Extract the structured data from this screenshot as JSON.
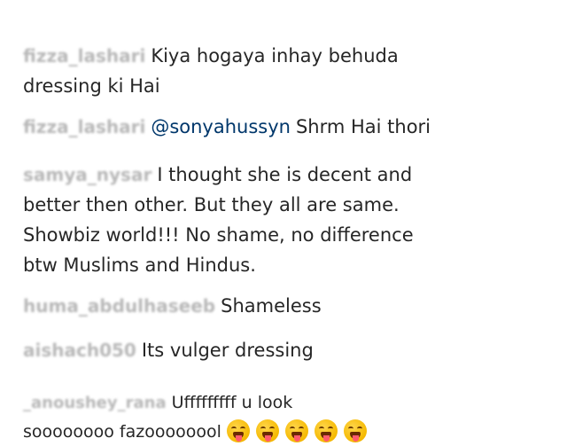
{
  "comments": [
    {
      "user": "fizza_lashari",
      "text": "Kiya hogaya inhay behuda\ndressing ki Hai"
    },
    {
      "user": "fizza_lashari",
      "mention": "@sonyahussyn",
      "text": "Shrm Hai thori"
    },
    {
      "user": "samya_nysar",
      "text": "I thought she is decent and\nbetter then other. But they all are same.\nShowbiz world!!! No shame, no difference\nbtw Muslims and Hindus."
    },
    {
      "user": "huma_abdulhaseeb",
      "text": "Shameless"
    },
    {
      "user": "aishach050",
      "text": "Its vulger dressing"
    },
    {
      "user": "_anoushey_rana",
      "text": "Ufffffffff u look\nsoooooooo fazoooooool"
    }
  ],
  "emojis": [
    "face-with-tongue-emoji",
    "face-with-tongue-emoji",
    "face-with-tongue-emoji",
    "face-with-tongue-emoji",
    "face-with-tongue-emoji"
  ]
}
